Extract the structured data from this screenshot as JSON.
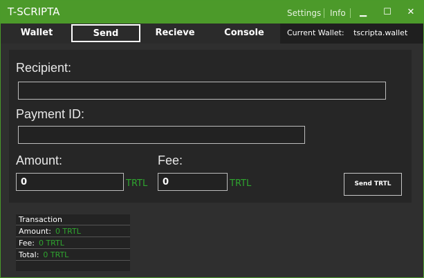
{
  "window": {
    "title": "T-SCRIPTA",
    "links": [
      "Settings",
      "Info"
    ],
    "controls": {
      "minimize": "▁",
      "maximize": "☐",
      "close": "✕"
    }
  },
  "nav": {
    "tabs": [
      {
        "label": "Wallet"
      },
      {
        "label": "Send"
      },
      {
        "label": "Recieve"
      },
      {
        "label": "Console"
      }
    ],
    "current_wallet_label": "Current Wallet:",
    "current_wallet_value": "tscripta.wallet"
  },
  "form": {
    "recipient_label": "Recipient:",
    "recipient_value": "",
    "payment_id_label": "Payment ID:",
    "payment_id_value": "",
    "amount_label": "Amount:",
    "amount_value": "0",
    "amount_unit": "TRTL",
    "fee_label": "Fee:",
    "fee_value": "0",
    "fee_unit": "TRTL",
    "send_button": "Send TRTL"
  },
  "summary": {
    "title": "Transaction",
    "amount_label": "Amount:",
    "amount_value": "0 TRTL",
    "fee_label": "Fee:",
    "fee_value": "0 TRTL",
    "total_label": "Total:",
    "total_value": "0 TRTL"
  },
  "colors": {
    "accent": "#4c9a2a",
    "value_green": "#2fa52f",
    "background": "#2f2f2f"
  }
}
